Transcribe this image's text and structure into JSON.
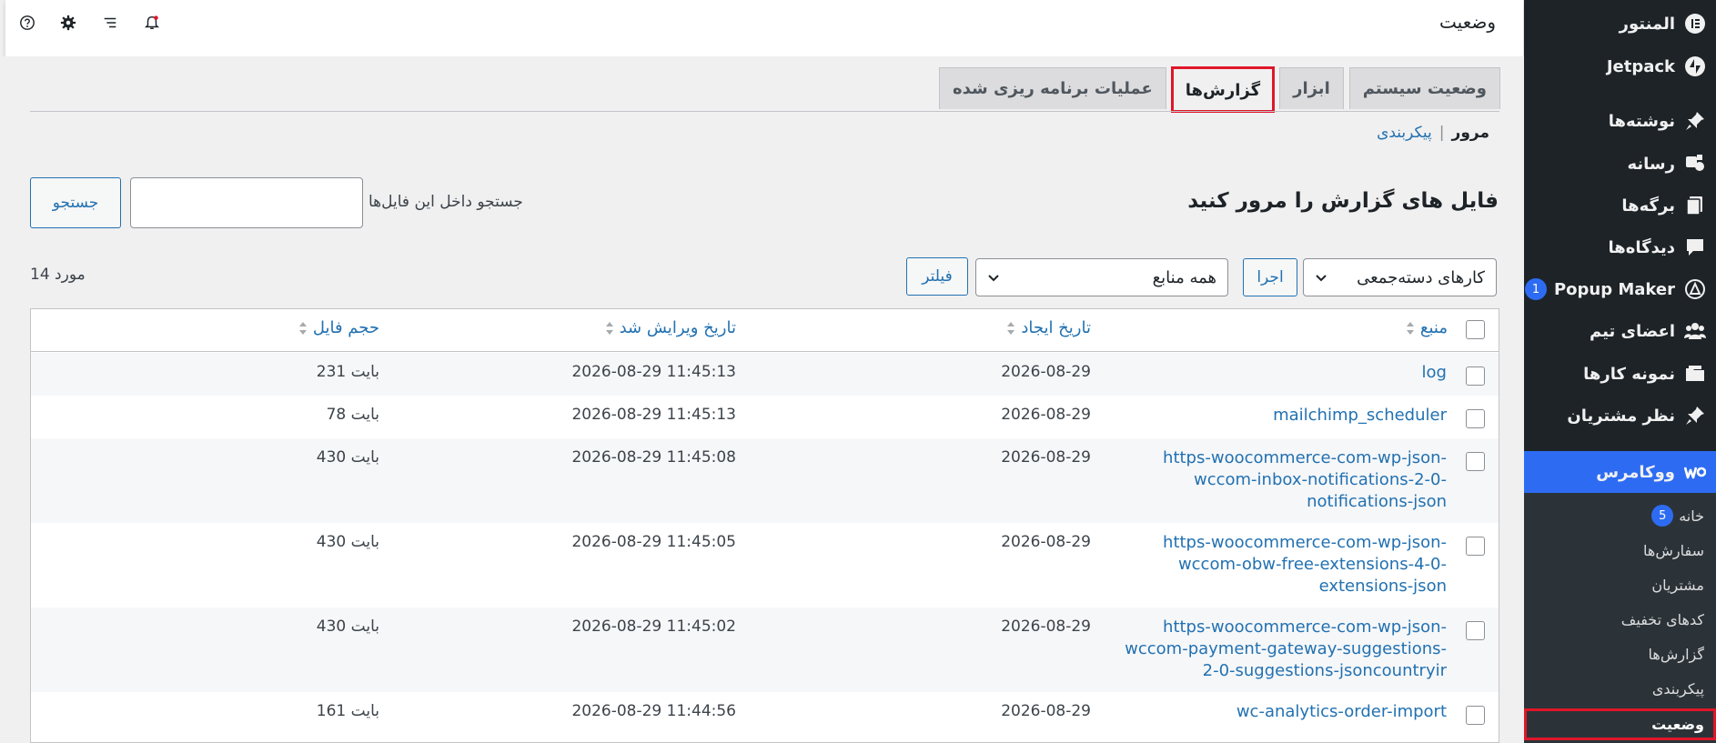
{
  "sidebar": {
    "items": [
      {
        "label": "المنتور",
        "icon": "elementor-icon"
      },
      {
        "label": "Jetpack",
        "icon": "jetpack-icon"
      },
      {
        "label": "نوشته‌ها",
        "icon": "pin-icon"
      },
      {
        "label": "رسانه",
        "icon": "media-icon"
      },
      {
        "label": "برگه‌ها",
        "icon": "pages-icon"
      },
      {
        "label": "دیدگاه‌ها",
        "icon": "comment-icon"
      },
      {
        "label": "Popup Maker",
        "icon": "popup-icon",
        "badge": "1"
      },
      {
        "label": "اعضای تیم",
        "icon": "team-icon"
      },
      {
        "label": "نمونه کارها",
        "icon": "portfolio-icon"
      },
      {
        "label": "نظر مشتریان",
        "icon": "pin-icon"
      },
      {
        "label": "ووکامرس",
        "icon": "woo-icon"
      }
    ],
    "submenu": [
      {
        "label": "خانه",
        "badge": "5"
      },
      {
        "label": "سفارش‌ها"
      },
      {
        "label": "مشتریان"
      },
      {
        "label": "کدهای تخفیف"
      },
      {
        "label": "گزارش‌ها"
      },
      {
        "label": "پیکربندی"
      },
      {
        "label": "وضعیت"
      }
    ]
  },
  "topbar": {
    "title": "وضعیت",
    "icons": [
      "notification-icon",
      "activity-icon",
      "settings-icon",
      "help-icon"
    ]
  },
  "tabs": [
    {
      "label": "وضعیت سیستم"
    },
    {
      "label": "ابزار"
    },
    {
      "label": "گزارش‌ها"
    },
    {
      "label": "عملیات برنامه ریزی شده"
    }
  ],
  "subnav": {
    "current": "مرور",
    "separator": "|",
    "link": "پیکربندی"
  },
  "browse": {
    "title": "فایل های گزارش را مرور کنید",
    "search_label": "جستجو داخل این فایل‌ها",
    "search_button": "جستجو"
  },
  "filters": {
    "bulk_actions": "کارهای دسته‌جمعی",
    "apply": "اجرا",
    "source": "همه منابع",
    "filter": "فیلتر",
    "count": "14 مورد"
  },
  "table": {
    "headers": {
      "source": "منبع",
      "created": "تاریخ ایجاد",
      "modified": "تاریخ ویرایش شد",
      "size": "حجم فایل"
    },
    "rows": [
      {
        "source": "log",
        "created": "2026-08-29",
        "modified": "2026-08-29 11:45:13",
        "size": "231 بایت"
      },
      {
        "source": "mailchimp_scheduler",
        "created": "2026-08-29",
        "modified": "2026-08-29 11:45:13",
        "size": "78 بایت"
      },
      {
        "source": "https-woocommerce-com-wp-json-wccom-inbox-notifications-2-0-notifications-json",
        "created": "2026-08-29",
        "modified": "2026-08-29 11:45:08",
        "size": "430 بایت"
      },
      {
        "source": "https-woocommerce-com-wp-json-wccom-obw-free-extensions-4-0-extensions-json",
        "created": "2026-08-29",
        "modified": "2026-08-29 11:45:05",
        "size": "430 بایت"
      },
      {
        "source": "https-woocommerce-com-wp-json-wccom-payment-gateway-suggestions-2-0-suggestions-jsoncountryir",
        "created": "2026-08-29",
        "modified": "2026-08-29 11:45:02",
        "size": "430 بایت"
      },
      {
        "source": "wc-analytics-order-import",
        "created": "2026-08-29",
        "modified": "2026-08-29 11:44:56",
        "size": "161 بایت"
      }
    ]
  },
  "colors": {
    "accent": "#2271b1",
    "highlight": "#e0162a",
    "sidebar": "#1d2327",
    "active_menu": "#2d6cf2"
  }
}
